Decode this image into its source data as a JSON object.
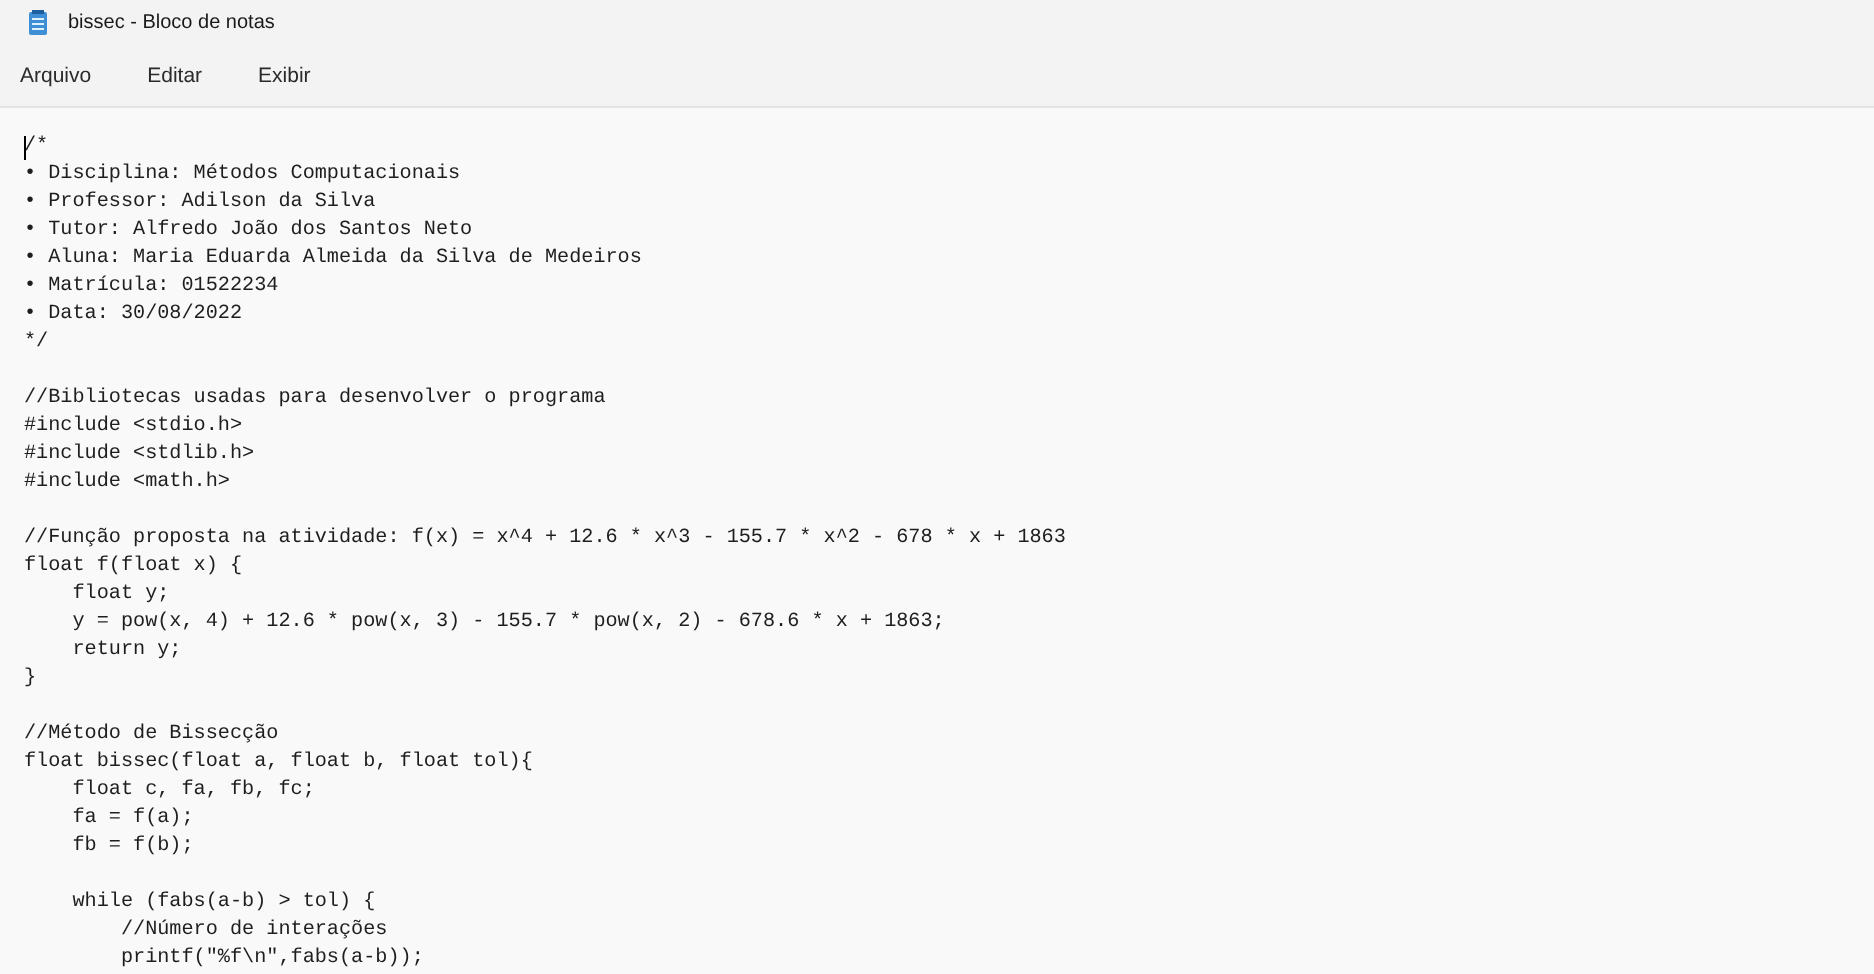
{
  "window": {
    "title": "bissec - Bloco de notas"
  },
  "menu": [
    {
      "label": "Arquivo"
    },
    {
      "label": "Editar"
    },
    {
      "label": "Exibir"
    }
  ],
  "editor": {
    "cursor_visible": true,
    "blocks": [
      [
        "/*",
        "• Disciplina: Métodos Computacionais",
        "• Professor: Adilson da Silva",
        "• Tutor: Alfredo João dos Santos Neto",
        "• Aluna: Maria Eduarda Almeida da Silva de Medeiros",
        "• Matrícula: 01522234",
        "• Data: 30/08/2022",
        "*/"
      ],
      [
        "//Bibliotecas usadas para desenvolver o programa",
        "#include <stdio.h>",
        "#include <stdlib.h>",
        "#include <math.h>"
      ],
      [
        "//Função proposta na atividade: f(x) = x^4 + 12.6 * x^3 - 155.7 * x^2 - 678 * x + 1863",
        "float f(float x) {",
        "    float y;",
        "    y = pow(x, 4) + 12.6 * pow(x, 3) - 155.7 * pow(x, 2) - 678.6 * x + 1863;",
        "    return y;",
        "}"
      ],
      [
        "//Método de Bissecção",
        "float bissec(float a, float b, float tol){",
        "    float c, fa, fb, fc;",
        "    fa = f(a);",
        "    fb = f(b);"
      ],
      [
        "    while (fabs(a-b) > tol) {",
        "        //Número de interações",
        "        printf(\"%f\\n\",fabs(a-b));"
      ]
    ]
  }
}
